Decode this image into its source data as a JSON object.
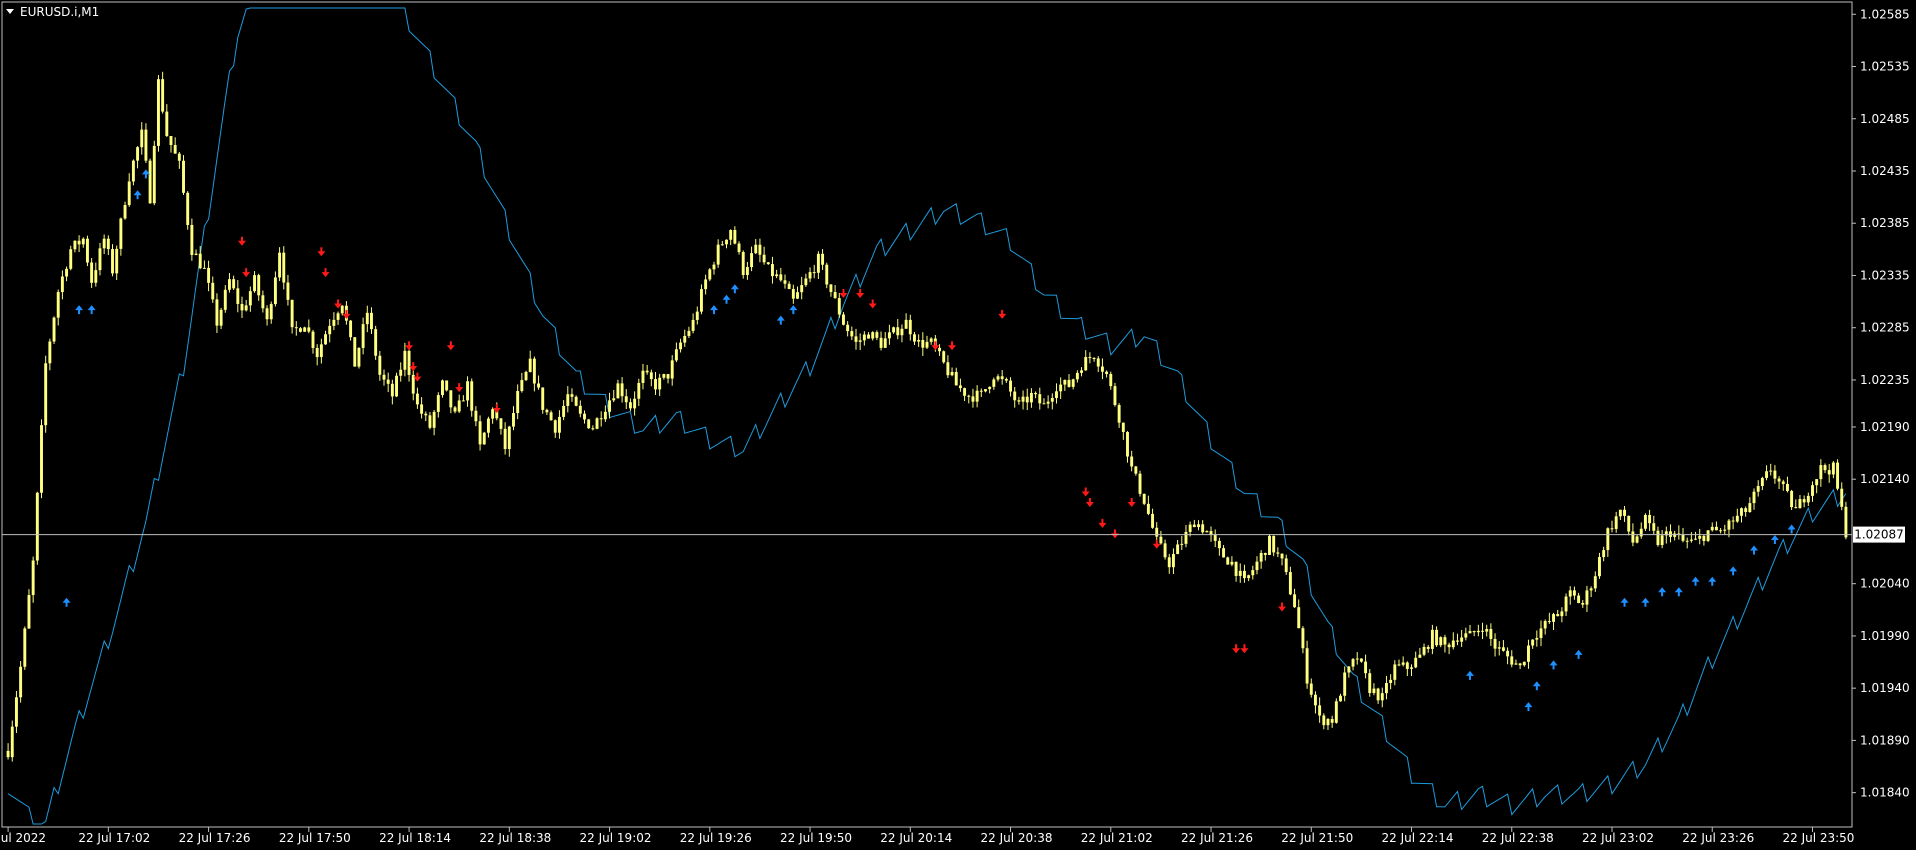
{
  "window": {
    "symbol_label": "EURUSD.i,M1",
    "collapse_icon": "triangle-down-icon"
  },
  "colors": {
    "background": "#000000",
    "frame": "#c0c0c0",
    "candle": "#ffff80",
    "ma_line": "#1e9bdc",
    "arrow_up": "#1e90ff",
    "arrow_down": "#ff1a1a",
    "bid_line": "#c0c0c0",
    "bid_label_bg": "#ffffff",
    "bid_label_text": "#000000"
  },
  "chart_data": {
    "type": "candlestick",
    "title": "EURUSD.i,M1",
    "ylim": [
      1.0181,
      1.02591
    ],
    "y_ticks": [
      "1.02585",
      "1.02535",
      "1.02485",
      "1.02435",
      "1.02385",
      "1.02335",
      "1.02285",
      "1.02235",
      "1.02190",
      "1.02140",
      "1.02087",
      "1.02040",
      "1.01990",
      "1.01940",
      "1.01890",
      "1.01840"
    ],
    "x_ticks": [
      "22 Jul 2022",
      "22 Jul 17:02",
      "22 Jul 17:26",
      "22 Jul 17:50",
      "22 Jul 18:14",
      "22 Jul 18:38",
      "22 Jul 19:02",
      "22 Jul 19:26",
      "22 Jul 19:50",
      "22 Jul 20:14",
      "22 Jul 20:38",
      "22 Jul 21:02",
      "22 Jul 21:26",
      "22 Jul 21:50",
      "22 Jul 22:14",
      "22 Jul 22:38",
      "22 Jul 23:02",
      "22 Jul 23:26",
      "22 Jul 23:50"
    ],
    "x_tick_step_bars": 24,
    "current_price": "1.02087",
    "price_anchors": [
      [
        0,
        1.0188
      ],
      [
        3,
        1.0196
      ],
      [
        6,
        1.0206
      ],
      [
        9,
        1.0225
      ],
      [
        12,
        1.0232
      ],
      [
        15,
        1.0236
      ],
      [
        18,
        1.0237
      ],
      [
        20,
        1.0233
      ],
      [
        23,
        1.0237
      ],
      [
        25,
        1.0234
      ],
      [
        29,
        1.0243
      ],
      [
        32,
        1.0247
      ],
      [
        34,
        1.0241
      ],
      [
        36,
        1.0252
      ],
      [
        38,
        1.0247
      ],
      [
        41,
        1.0244
      ],
      [
        44,
        1.0236
      ],
      [
        47,
        1.0234
      ],
      [
        50,
        1.0229
      ],
      [
        53,
        1.0233
      ],
      [
        56,
        1.023
      ],
      [
        59,
        1.0233
      ],
      [
        62,
        1.0229
      ],
      [
        65,
        1.0236
      ],
      [
        68,
        1.0228
      ],
      [
        71,
        1.0229
      ],
      [
        74,
        1.0226
      ],
      [
        77,
        1.0229
      ],
      [
        80,
        1.0231
      ],
      [
        83,
        1.0225
      ],
      [
        86,
        1.023
      ],
      [
        89,
        1.0224
      ],
      [
        92,
        1.0222
      ],
      [
        95,
        1.0226
      ],
      [
        98,
        1.0221
      ],
      [
        101,
        1.0219
      ],
      [
        104,
        1.0223
      ],
      [
        107,
        1.022
      ],
      [
        110,
        1.0223
      ],
      [
        113,
        1.0217
      ],
      [
        116,
        1.0221
      ],
      [
        119,
        1.0217
      ],
      [
        122,
        1.0222
      ],
      [
        125,
        1.0225
      ],
      [
        128,
        1.0221
      ],
      [
        131,
        1.0219
      ],
      [
        134,
        1.0222
      ],
      [
        137,
        1.022
      ],
      [
        140,
        1.0219
      ],
      [
        143,
        1.0221
      ],
      [
        146,
        1.0223
      ],
      [
        149,
        1.0221
      ],
      [
        152,
        1.0224
      ],
      [
        155,
        1.0223
      ],
      [
        158,
        1.0224
      ],
      [
        161,
        1.0227
      ],
      [
        164,
        1.0229
      ],
      [
        167,
        1.0233
      ],
      [
        170,
        1.0236
      ],
      [
        173,
        1.0238
      ],
      [
        176,
        1.0234
      ],
      [
        179,
        1.0236
      ],
      [
        182,
        1.0234
      ],
      [
        185,
        1.0233
      ],
      [
        188,
        1.0231
      ],
      [
        191,
        1.0233
      ],
      [
        194,
        1.0235
      ],
      [
        197,
        1.0232
      ],
      [
        200,
        1.0229
      ],
      [
        203,
        1.0227
      ],
      [
        206,
        1.0228
      ],
      [
        209,
        1.0227
      ],
      [
        212,
        1.0228
      ],
      [
        215,
        1.0229
      ],
      [
        218,
        1.0227
      ],
      [
        221,
        1.0227
      ],
      [
        224,
        1.0225
      ],
      [
        227,
        1.0223
      ],
      [
        230,
        1.0222
      ],
      [
        233,
        1.0222
      ],
      [
        236,
        1.0224
      ],
      [
        239,
        1.0223
      ],
      [
        242,
        1.0221
      ],
      [
        245,
        1.0222
      ],
      [
        248,
        1.0221
      ],
      [
        251,
        1.0223
      ],
      [
        254,
        1.0223
      ],
      [
        257,
        1.0225
      ],
      [
        260,
        1.0226
      ],
      [
        263,
        1.0224
      ],
      [
        266,
        1.022
      ],
      [
        269,
        1.0215
      ],
      [
        272,
        1.0212
      ],
      [
        275,
        1.0208
      ],
      [
        278,
        1.0206
      ],
      [
        281,
        1.0208
      ],
      [
        284,
        1.021
      ],
      [
        287,
        1.0209
      ],
      [
        290,
        1.0207
      ],
      [
        293,
        1.0206
      ],
      [
        296,
        1.0204
      ],
      [
        299,
        1.0206
      ],
      [
        302,
        1.0208
      ],
      [
        305,
        1.0206
      ],
      [
        308,
        1.0202
      ],
      [
        311,
        1.0195
      ],
      [
        314,
        1.0191
      ],
      [
        317,
        1.0191
      ],
      [
        320,
        1.0195
      ],
      [
        323,
        1.0197
      ],
      [
        326,
        1.0194
      ],
      [
        329,
        1.0193
      ],
      [
        332,
        1.0196
      ],
      [
        335,
        1.0196
      ],
      [
        338,
        1.0197
      ],
      [
        341,
        1.0199
      ],
      [
        344,
        1.0198
      ],
      [
        347,
        1.0199
      ],
      [
        350,
        1.0199
      ],
      [
        353,
        1.02
      ],
      [
        356,
        1.0198
      ],
      [
        359,
        1.0197
      ],
      [
        362,
        1.0196
      ],
      [
        365,
        1.0199
      ],
      [
        368,
        1.02
      ],
      [
        371,
        1.0201
      ],
      [
        374,
        1.0203
      ],
      [
        377,
        1.0202
      ],
      [
        380,
        1.0205
      ],
      [
        383,
        1.0209
      ],
      [
        386,
        1.0211
      ],
      [
        389,
        1.0208
      ],
      [
        392,
        1.021
      ],
      [
        395,
        1.0208
      ],
      [
        398,
        1.0209
      ],
      [
        401,
        1.0208
      ],
      [
        404,
        1.0208
      ],
      [
        407,
        1.0209
      ],
      [
        410,
        1.0209
      ],
      [
        413,
        1.021
      ],
      [
        416,
        1.0211
      ],
      [
        419,
        1.0213
      ],
      [
        422,
        1.0215
      ],
      [
        425,
        1.0213
      ],
      [
        428,
        1.0211
      ],
      [
        431,
        1.0213
      ],
      [
        434,
        1.0215
      ],
      [
        437,
        1.0215
      ],
      [
        440,
        1.0209
      ]
    ],
    "ma_anchors": [
      [
        0,
        1.0185
      ],
      [
        8,
        1.018
      ],
      [
        16,
        1.019
      ],
      [
        25,
        1.02
      ],
      [
        33,
        1.021
      ],
      [
        42,
        1.0225
      ],
      [
        48,
        1.024
      ],
      [
        52,
        1.025
      ],
      [
        55,
        1.0257
      ],
      [
        60,
        1.0262
      ],
      [
        66,
        1.0265
      ],
      [
        72,
        1.0262
      ],
      [
        80,
        1.0266
      ],
      [
        88,
        1.0264
      ],
      [
        96,
        1.0258
      ],
      [
        104,
        1.0252
      ],
      [
        112,
        1.0246
      ],
      [
        120,
        1.0238
      ],
      [
        128,
        1.023
      ],
      [
        136,
        1.0224
      ],
      [
        144,
        1.0221
      ],
      [
        152,
        1.0219
      ],
      [
        160,
        1.022
      ],
      [
        168,
        1.0218
      ],
      [
        176,
        1.0217
      ],
      [
        184,
        1.0221
      ],
      [
        192,
        1.0225
      ],
      [
        200,
        1.0231
      ],
      [
        208,
        1.0236
      ],
      [
        216,
        1.0238
      ],
      [
        224,
        1.024
      ],
      [
        232,
        1.0239
      ],
      [
        240,
        1.0237
      ],
      [
        248,
        1.0232
      ],
      [
        256,
        1.0229
      ],
      [
        264,
        1.0227
      ],
      [
        272,
        1.0228
      ],
      [
        280,
        1.0224
      ],
      [
        288,
        1.0218
      ],
      [
        296,
        1.0213
      ],
      [
        304,
        1.021
      ],
      [
        310,
        1.0206
      ],
      [
        316,
        1.02
      ],
      [
        322,
        1.0195
      ],
      [
        330,
        1.019
      ],
      [
        336,
        1.0186
      ],
      [
        344,
        1.0183
      ],
      [
        352,
        1.0184
      ],
      [
        360,
        1.0183
      ],
      [
        368,
        1.0184
      ],
      [
        376,
        1.0184
      ],
      [
        384,
        1.0185
      ],
      [
        392,
        1.0187
      ],
      [
        400,
        1.0191
      ],
      [
        408,
        1.0197
      ],
      [
        416,
        1.0202
      ],
      [
        424,
        1.0207
      ],
      [
        432,
        1.0211
      ],
      [
        440,
        1.0213
      ]
    ],
    "arrows_up": [
      [
        14,
        1.0204
      ],
      [
        17,
        1.0232
      ],
      [
        20,
        1.0232
      ],
      [
        31,
        1.0243
      ],
      [
        33,
        1.0245
      ],
      [
        169,
        1.0232
      ],
      [
        172,
        1.0233
      ],
      [
        174,
        1.0234
      ],
      [
        185,
        1.0231
      ],
      [
        188,
        1.0232
      ],
      [
        350,
        1.0197
      ],
      [
        364,
        1.0194
      ],
      [
        366,
        1.0196
      ],
      [
        370,
        1.0198
      ],
      [
        376,
        1.0199
      ],
      [
        387,
        1.0204
      ],
      [
        392,
        1.0204
      ],
      [
        396,
        1.0205
      ],
      [
        400,
        1.0205
      ],
      [
        404,
        1.0206
      ],
      [
        408,
        1.0206
      ],
      [
        413,
        1.0207
      ],
      [
        418,
        1.0209
      ],
      [
        423,
        1.021
      ],
      [
        427,
        1.0211
      ]
    ],
    "arrows_down": [
      [
        56,
        1.0235
      ],
      [
        57,
        1.0232
      ],
      [
        75,
        1.0234
      ],
      [
        76,
        1.0232
      ],
      [
        79,
        1.0229
      ],
      [
        81,
        1.0228
      ],
      [
        96,
        1.0225
      ],
      [
        97,
        1.0223
      ],
      [
        98,
        1.0222
      ],
      [
        106,
        1.0225
      ],
      [
        108,
        1.0221
      ],
      [
        117,
        1.0219
      ],
      [
        200,
        1.023
      ],
      [
        204,
        1.023
      ],
      [
        207,
        1.0229
      ],
      [
        222,
        1.0225
      ],
      [
        226,
        1.0225
      ],
      [
        238,
        1.0228
      ],
      [
        258,
        1.0211
      ],
      [
        259,
        1.021
      ],
      [
        262,
        1.0208
      ],
      [
        265,
        1.0207
      ],
      [
        269,
        1.021
      ],
      [
        275,
        1.0206
      ],
      [
        294,
        1.0196
      ],
      [
        296,
        1.0196
      ],
      [
        305,
        1.02
      ]
    ]
  }
}
